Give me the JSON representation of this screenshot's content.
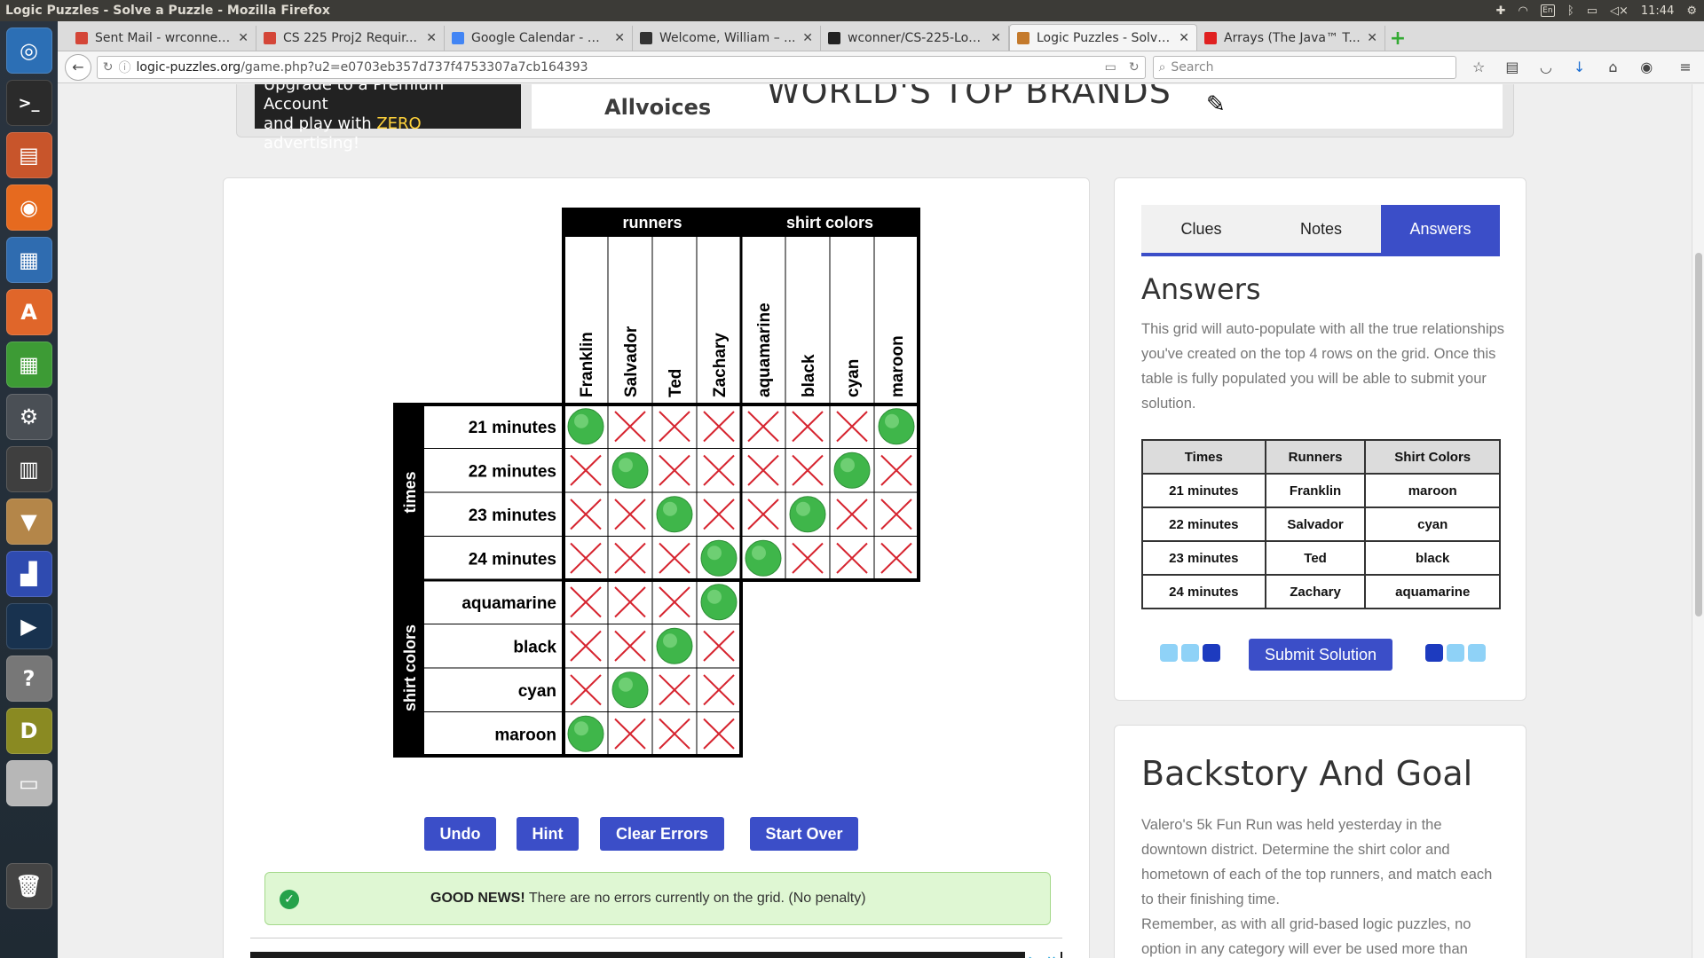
{
  "os": {
    "window_title": "Logic Puzzles - Solve a Puzzle - Mozilla Firefox",
    "clock": "11:44",
    "keyboard_layout": "En"
  },
  "browser": {
    "tabs": [
      {
        "title": "Sent Mail - wrconner...",
        "favicon_color": "#d44638"
      },
      {
        "title": "CS 225 Proj2 Requir...",
        "favicon_color": "#d44638"
      },
      {
        "title": "Google Calendar - M...",
        "favicon_color": "#4285f4"
      },
      {
        "title": "Welcome, William – ...",
        "favicon_color": "#333333"
      },
      {
        "title": "wconner/CS-225-Log...",
        "favicon_color": "#222222"
      },
      {
        "title": "Logic Puzzles - Solve...",
        "favicon_color": "#c47a2c"
      },
      {
        "title": "Arrays (The Java™ T...",
        "favicon_color": "#e02020"
      }
    ],
    "active_tab_index": 5,
    "url_host": "logic-puzzles.org",
    "url_path": "/game.php?u2=e0703eb357d737f4753307a7cb164393",
    "search_placeholder": "Search"
  },
  "ad_top": {
    "premium_line1": "Upgrade to a Premium Account",
    "premium_line2_pre": "and play with ",
    "premium_line2_zero": "ZERO",
    "premium_line2_post": " advertising!",
    "allvoices": "Allvoices",
    "brands": "WORLD'S TOP BRANDS"
  },
  "grid": {
    "col_groups": [
      "runners",
      "shirt colors"
    ],
    "row_groups": [
      "times",
      "shirt colors"
    ],
    "columns": [
      "Franklin",
      "Salvador",
      "Ted",
      "Zachary",
      "aquamarine",
      "black",
      "cyan",
      "maroon"
    ],
    "rows": [
      "21 minutes",
      "22 minutes",
      "23 minutes",
      "24 minutes",
      "aquamarine",
      "black",
      "cyan",
      "maroon"
    ],
    "cells": [
      [
        "O",
        "X",
        "X",
        "X",
        "X",
        "X",
        "X",
        "O"
      ],
      [
        "X",
        "O",
        "X",
        "X",
        "X",
        "X",
        "O",
        "X"
      ],
      [
        "X",
        "X",
        "O",
        "X",
        "X",
        "O",
        "X",
        "X"
      ],
      [
        "X",
        "X",
        "X",
        "O",
        "O",
        "X",
        "X",
        "X"
      ],
      [
        "X",
        "X",
        "X",
        "O"
      ],
      [
        "X",
        "X",
        "O",
        "X"
      ],
      [
        "X",
        "O",
        "X",
        "X"
      ],
      [
        "O",
        "X",
        "X",
        "X"
      ]
    ]
  },
  "buttons": {
    "undo": "Undo",
    "hint": "Hint",
    "clear_errors": "Clear Errors",
    "start_over": "Start Over"
  },
  "status": {
    "bold": "GOOD NEWS!",
    "text": " There are no errors currently on the grid. (No penalty)"
  },
  "panel": {
    "tabs": [
      "Clues",
      "Notes",
      "Answers"
    ],
    "active_tab": "Answers",
    "title": "Answers",
    "description": "This grid will auto-populate with all the true relationships you've created on the top 4 rows on the grid. Once this table is fully populated you will be able to submit your solution.",
    "table": {
      "headers": [
        "Times",
        "Runners",
        "Shirt Colors"
      ],
      "rows": [
        [
          "21 minutes",
          "Franklin",
          "maroon"
        ],
        [
          "22 minutes",
          "Salvador",
          "cyan"
        ],
        [
          "23 minutes",
          "Ted",
          "black"
        ],
        [
          "24 minutes",
          "Zachary",
          "aquamarine"
        ]
      ]
    },
    "submit_label": "Submit Solution"
  },
  "backstory": {
    "title": "Backstory And Goal",
    "p1": "Valero's 5k Fun Run was held yesterday in the downtown district. Determine the shirt color and hometown of each of the top runners, and match each to their finishing time.",
    "p2": "Remember, as with all grid-based logic puzzles, no option in any category will ever be used more than"
  }
}
